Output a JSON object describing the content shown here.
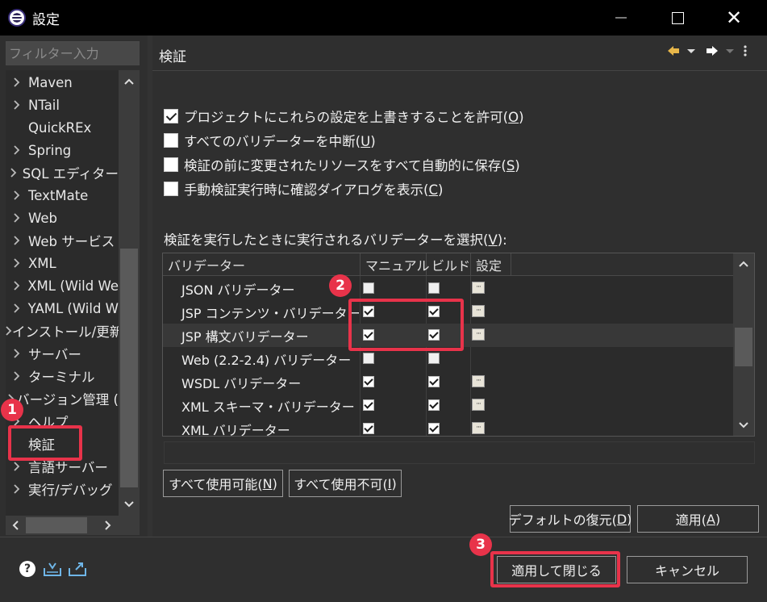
{
  "window": {
    "title": "設定",
    "icon": "eclipse-icon"
  },
  "sidebar": {
    "filter_placeholder": "フィルター入力",
    "items": [
      {
        "label": "Maven",
        "expandable": true
      },
      {
        "label": "NTail",
        "expandable": true
      },
      {
        "label": "QuickREx",
        "expandable": false
      },
      {
        "label": "Spring",
        "expandable": true
      },
      {
        "label": "SQL エディター",
        "expandable": true
      },
      {
        "label": "TextMate",
        "expandable": true
      },
      {
        "label": "Web",
        "expandable": true
      },
      {
        "label": "Web サービス",
        "expandable": true
      },
      {
        "label": "XML",
        "expandable": true
      },
      {
        "label": "XML (Wild We",
        "expandable": true
      },
      {
        "label": "YAML (Wild W",
        "expandable": true
      },
      {
        "label": "インストール/更新",
        "expandable": true
      },
      {
        "label": "サーバー",
        "expandable": true
      },
      {
        "label": "ターミナル",
        "expandable": true
      },
      {
        "label": "バージョン管理 (",
        "expandable": true
      },
      {
        "label": "ヘルプ",
        "expandable": true
      },
      {
        "label": "検証",
        "expandable": false
      },
      {
        "label": "言語サーバー",
        "expandable": true
      },
      {
        "label": "実行/デバッグ",
        "expandable": true
      }
    ]
  },
  "page": {
    "title": "検証",
    "options": [
      {
        "text": "プロジェクトにこれらの設定を上書きすることを許可(",
        "mnemonic": "O",
        "suffix": ")",
        "checked": true
      },
      {
        "text": "すべてのバリデーターを中断(",
        "mnemonic": "U",
        "suffix": ")",
        "checked": false
      },
      {
        "text": "検証の前に変更されたリソースをすべて自動的に保存(",
        "mnemonic": "S",
        "suffix": ")",
        "checked": false
      },
      {
        "text": "手動検証実行時に確認ダイアログを表示(",
        "mnemonic": "C",
        "suffix": ")",
        "checked": false
      }
    ],
    "select_label": "検証を実行したときに実行されるバリデーターを選択(",
    "select_mnemonic": "V",
    "select_suffix": "):",
    "table": {
      "columns": [
        "バリデーター",
        "マニュアル",
        "ビルド",
        "設定"
      ],
      "rows": [
        {
          "name": "JSON バリデーター",
          "manual": false,
          "build": false,
          "settings": true
        },
        {
          "name": "JSP コンテンツ・バリデーター",
          "manual": true,
          "build": true,
          "settings": true
        },
        {
          "name": "JSP 構文バリデーター",
          "manual": true,
          "build": true,
          "settings": true
        },
        {
          "name": "Web (2.2-2.4) バリデーター",
          "manual": false,
          "build": false,
          "settings": false
        },
        {
          "name": "WSDL バリデーター",
          "manual": true,
          "build": true,
          "settings": true
        },
        {
          "name": "XML スキーマ・バリデーター",
          "manual": true,
          "build": true,
          "settings": true
        },
        {
          "name": "XML バリデーター",
          "manual": true,
          "build": true,
          "settings": true
        }
      ]
    },
    "buttons": {
      "enable_all": "すべて使用可能(",
      "enable_all_m": "N",
      "enable_all_s": ")",
      "disable_all": "すべて使用不可(",
      "disable_all_m": "I",
      "disable_all_s": ")",
      "restore_defaults": "デフォルトの復元(",
      "restore_defaults_m": "D",
      "restore_defaults_s": ")",
      "apply": "適用(",
      "apply_m": "A",
      "apply_s": ")"
    }
  },
  "footer": {
    "apply_close": "適用して閉じる",
    "cancel": "キャンセル"
  },
  "annotations": {
    "badge1": "1",
    "badge2": "2",
    "badge3": "3",
    "color": "#e8334a"
  }
}
